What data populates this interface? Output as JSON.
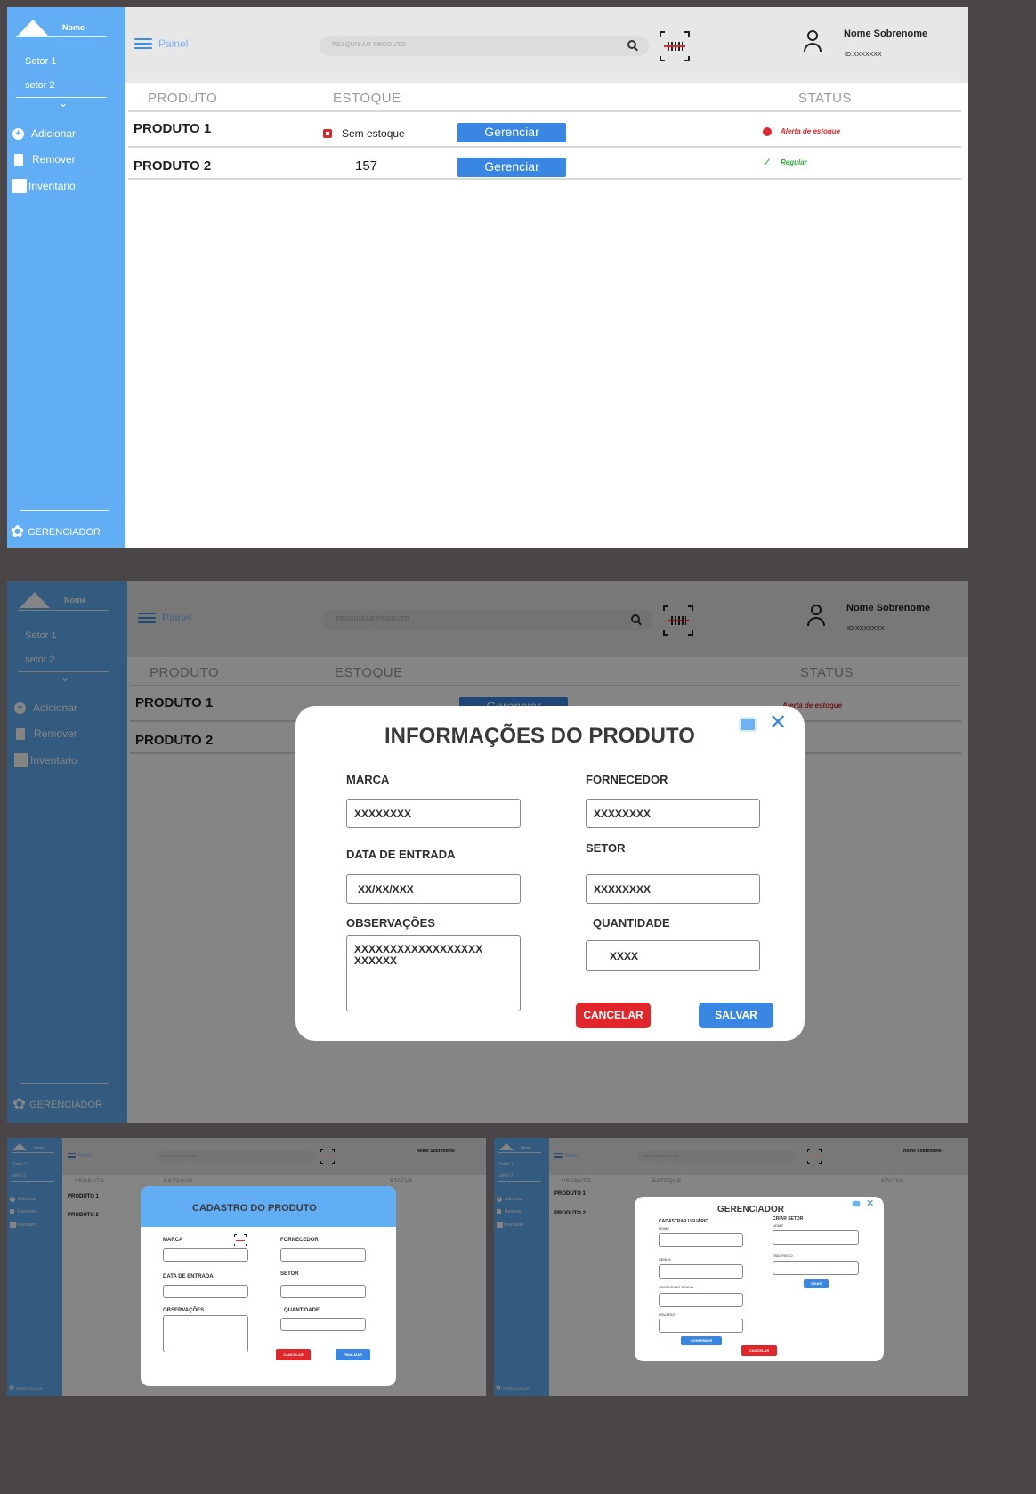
{
  "app": {
    "logo_name": "Nome",
    "setor1": "Setor 1",
    "setor2": "setor 2",
    "chevron": "⌄",
    "menu": {
      "adicionar": "Adicionar",
      "remover": "Remover",
      "inventario": "Inventario"
    },
    "footer": "GERENCIADOR",
    "painel": "Painel",
    "search_placeholder": "PESQUISAR PRODUTO",
    "user_name": "Nome Sobrenome",
    "user_id": "ID:XXXXXXX"
  },
  "table": {
    "headers": {
      "produto": "PRODUTO",
      "estoque": "ESTOQUE",
      "status": "STATUS"
    },
    "rows": [
      {
        "produto": "PRODUTO 1",
        "estoque": "Sem estoque",
        "action": "Gerenciar",
        "status": "Alerta de estoque"
      },
      {
        "produto": "PRODUTO 2",
        "estoque": "157",
        "action": "Gerenciar",
        "status": "Regular"
      }
    ]
  },
  "info_modal": {
    "title": "INFORMAÇÕES DO PRODUTO",
    "marca_label": "MARCA",
    "marca_value": "XXXXXXXX",
    "fornecedor_label": "FORNECEDOR",
    "fornecedor_value": "XXXXXXXX",
    "data_label": "DATA DE ENTRADA",
    "data_value": "XX/XX/XXX",
    "setor_label": "SETOR",
    "setor_value": "XXXXXXXX",
    "obs_label": "OBSERVAÇÕES",
    "obs_value": "XXXXXXXXXXXXXXXXXX\nXXXXXX",
    "qtd_label": "QUANTIDADE",
    "qtd_value": "XXXX",
    "cancel": "CANCELAR",
    "save": "SALVAR"
  },
  "cadastro_modal": {
    "title": "CADASTRO DO PRODUTO",
    "marca": "MARCA",
    "fornecedor": "FORNECEDOR",
    "data": "DATA DE ENTRADA",
    "setor": "SETOR",
    "obs": "OBSERVAÇÕES",
    "qtd": "QUANTIDADE",
    "cancel": "CANCELAR",
    "finish": "FINALIZAR"
  },
  "gerenciador_modal": {
    "title": "GERENCIADOR",
    "cad_usuario": "CADASTRAR USUÁRIO",
    "criar_setor": "CRIAR SETOR",
    "nome1": "NOME",
    "nome2": "NOME",
    "senha": "SENHA",
    "endereco": "ENDEREÇO",
    "confirmar_senha": "CONFIRMAR SENHA",
    "usuario": "USUÁRIO",
    "criar": "CRIAR",
    "confirmar": "CONFIRMAR",
    "cancel": "CANCELAR"
  },
  "colors": {
    "sidebar": "#62aef5",
    "accent": "#3a86e3",
    "danger": "#e0262b",
    "success": "#2fae3a"
  }
}
